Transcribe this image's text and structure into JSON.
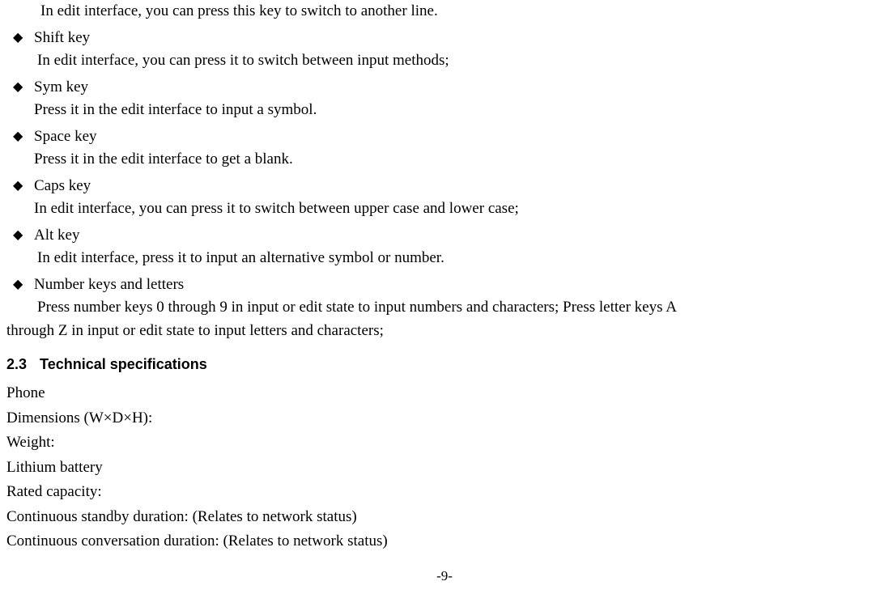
{
  "firstLine": "In edit interface, you can press this key to switch to another line.",
  "bullets": [
    {
      "title": "Shift key",
      "desc": "In edit interface, you can press it to switch between input methods;",
      "indent": true
    },
    {
      "title": "Sym key",
      "desc": "Press it in the edit interface to input a symbol.",
      "indent": false
    },
    {
      "title": "Space key",
      "desc": "Press it in the edit interface to get a blank.",
      "indent": false
    },
    {
      "title": "Caps key",
      "desc": "In edit interface, you can press it to switch between upper case and lower case;",
      "indent": false
    },
    {
      "title": "Alt key",
      "desc": "In edit interface, press it to input an alternative symbol or number.",
      "indent": true
    },
    {
      "title": "Number keys and letters",
      "desc": "Press number keys 0 through 9 in input or edit state to input numbers and characters; Press letter keys A",
      "indent": true
    }
  ],
  "lastContinuation": "through Z in input or edit state to input letters and characters;",
  "section": {
    "num": "2.3",
    "title": "Technical specifications"
  },
  "specs": [
    "Phone",
    "Dimensions (W×D×H):",
    "Weight:",
    "Lithium battery",
    "Rated capacity:",
    "Continuous standby duration: (Relates to network status)",
    "Continuous conversation duration: (Relates to network status)"
  ],
  "pageNumber": "-9-"
}
